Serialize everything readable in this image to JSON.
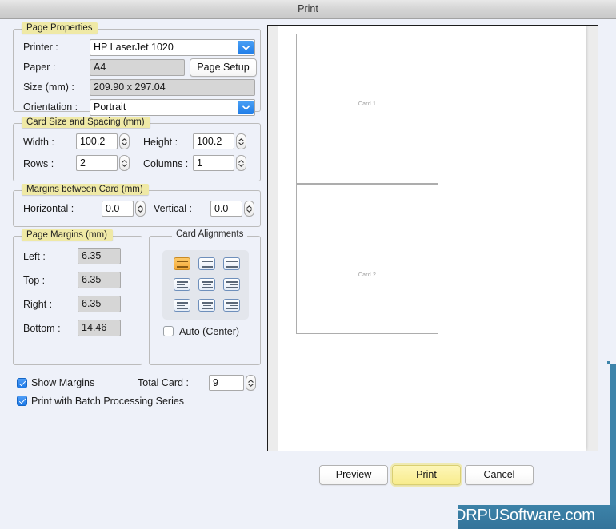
{
  "window": {
    "title": "Print"
  },
  "page_properties": {
    "group_label": "Page Properties",
    "printer_label": "Printer :",
    "printer_value": "HP LaserJet 1020",
    "paper_label": "Paper :",
    "paper_value": "A4",
    "page_setup_button": "Page Setup",
    "size_label": "Size (mm) :",
    "size_value": "209.90 x 297.04",
    "orientation_label": "Orientation :",
    "orientation_value": "Portrait"
  },
  "card_size": {
    "group_label": "Card Size and Spacing (mm)",
    "width_label": "Width :",
    "width_value": "100.2",
    "height_label": "Height :",
    "height_value": "100.2",
    "rows_label": "Rows :",
    "rows_value": "2",
    "columns_label": "Columns :",
    "columns_value": "1"
  },
  "margins_between": {
    "group_label": "Margins between Card (mm)",
    "horizontal_label": "Horizontal :",
    "horizontal_value": "0.0",
    "vertical_label": "Vertical :",
    "vertical_value": "0.0"
  },
  "page_margins": {
    "group_label": "Page Margins (mm)",
    "left_label": "Left :",
    "left_value": "6.35",
    "top_label": "Top :",
    "top_value": "6.35",
    "right_label": "Right :",
    "right_value": "6.35",
    "bottom_label": "Bottom :",
    "bottom_value": "14.46"
  },
  "card_alignments": {
    "group_label": "Card Alignments",
    "selected_index": 0,
    "auto_center_label": "Auto (Center)",
    "auto_center_checked": false
  },
  "options": {
    "show_margins_label": "Show Margins",
    "show_margins_checked": true,
    "batch_label": "Print with Batch Processing Series",
    "batch_checked": true,
    "total_card_label": "Total Card :",
    "total_card_value": "9"
  },
  "preview": {
    "cards": [
      {
        "label": "Card 1"
      },
      {
        "label": "Card 2"
      }
    ]
  },
  "footer": {
    "preview_button": "Preview",
    "print_button": "Print",
    "cancel_button": "Cancel"
  },
  "watermark": {
    "text": "DRPUSoftware.com"
  },
  "colors": {
    "accent_blue": "#1f7de8",
    "group_label_yellow": "#efe9a6",
    "default_button_yellow": "#f8ec8d",
    "watermark_teal": "#3c82a8",
    "selected_align_orange": "#f5ab3a"
  }
}
